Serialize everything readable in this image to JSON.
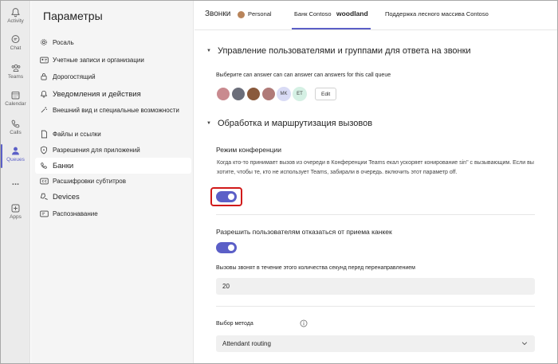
{
  "rail": {
    "items": [
      {
        "label": "Activity"
      },
      {
        "label": "Chat"
      },
      {
        "label": "Teams"
      },
      {
        "label": "Calendar"
      },
      {
        "label": "Calls"
      },
      {
        "label": "Queues"
      },
      {
        "label": "..."
      },
      {
        "label": "Apps"
      }
    ],
    "active": "Queues",
    "accent": "#5b5fc7"
  },
  "settings": {
    "title": "Параметры",
    "items": [
      {
        "label": "Росаль",
        "icon": "gear-icon"
      },
      {
        "label": "Учетные записи и организации",
        "icon": "id-card-icon"
      },
      {
        "label": "Дорогостящий",
        "icon": "lock-icon"
      },
      {
        "label": "Уведомления и действия",
        "icon": "bell-icon"
      },
      {
        "label": "Внешний вид и специальные возможности",
        "icon": "wand-icon"
      },
      {
        "label": "Файлы и ссылки",
        "icon": "file-icon"
      },
      {
        "label": "Разрешения для приложений",
        "icon": "shield-icon"
      },
      {
        "label": "Банки",
        "icon": "phone-icon"
      },
      {
        "label": "Расшифровки субтитров",
        "icon": "captions-icon"
      },
      {
        "label": "Devices",
        "icon": "devices-icon"
      },
      {
        "label": "Распознавание",
        "icon": "recognition-icon"
      }
    ],
    "active": "Банки"
  },
  "tabs": {
    "items": [
      {
        "label": "Звонки"
      },
      {
        "label": "Personal"
      },
      {
        "label": "Банк Contoso"
      },
      {
        "label": "woodland"
      },
      {
        "label": "Поддержка лесного массива Contoso"
      }
    ],
    "active": "Банк Contoso"
  },
  "section1": {
    "title": "Управление пользователями и группами для ответа на звонки",
    "description": "Выберите can answer can can answer can answers for this call queue",
    "avatars": [
      "MK",
      "ET"
    ],
    "edit_label": "Edit"
  },
  "section2": {
    "title": "Обработка и маршрутизация вызовов",
    "conference_label": "Режим конференции",
    "conference_desc": "Когда кто-то принимает вызов из очереди в Конференции Teams екал ускоряет конирование sin\" с вызывающим. Если вы хотите, чтобы те, кто не использует Teams, забирали в очередь. включить этот параметр off.",
    "conference_on": true,
    "optout_label": "Разрешить пользователям отказаться от приема канкек",
    "optout_on": true,
    "seconds_label": "Вызовы звонят в течение этого количества секунд перед перенаправлением",
    "seconds_value": "20",
    "method_label": "Выбор метода",
    "method_value": "Attendant routing"
  }
}
